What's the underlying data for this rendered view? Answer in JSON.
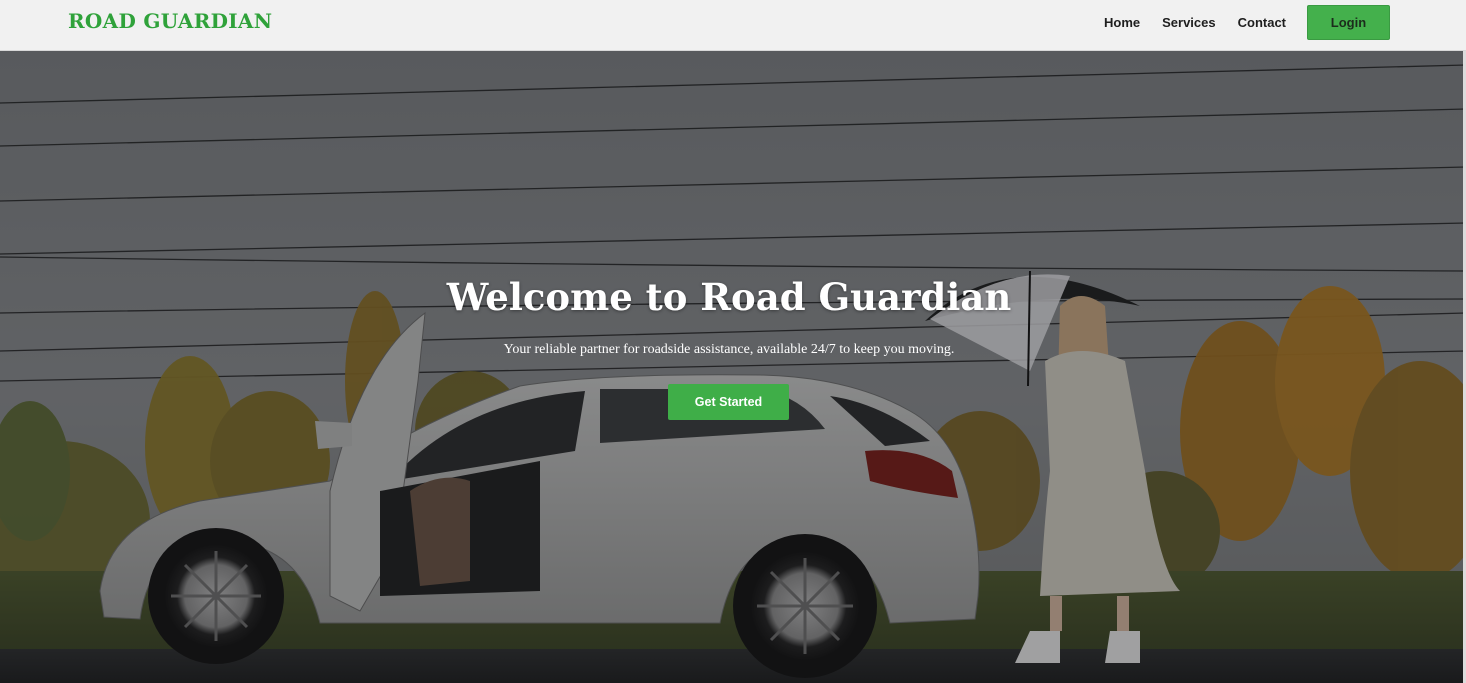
{
  "navbar": {
    "brand": "ROAD GUARDIAN",
    "links": [
      "Home",
      "Services",
      "Contact"
    ],
    "login_label": "Login"
  },
  "hero": {
    "title": "Welcome to Road Guardian",
    "subtitle": "Your reliable partner for roadside assistance, available 24/7 to keep you moving.",
    "cta_label": "Get Started"
  },
  "colors": {
    "brand": "#2fa23a",
    "button": "#44b04c",
    "navbar_bg": "#f1f1f1"
  }
}
